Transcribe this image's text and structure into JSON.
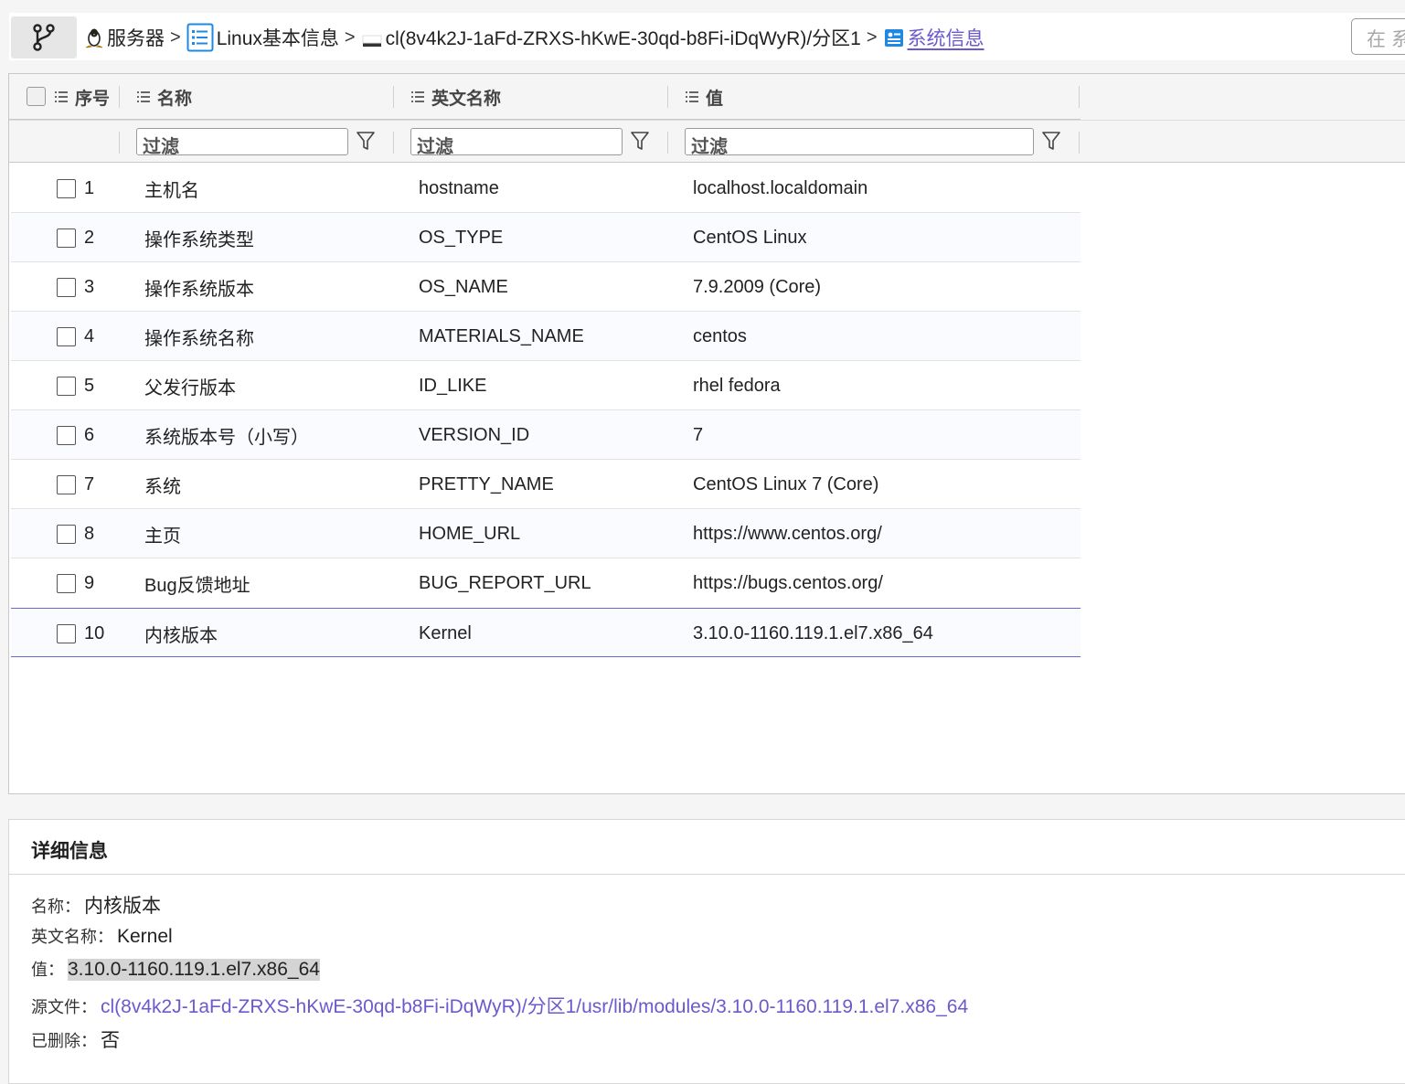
{
  "breadcrumb": {
    "items": [
      {
        "label": "服务器",
        "icon": "linux-penguin-icon"
      },
      {
        "label": "Linux基本信息",
        "icon": "list-icon"
      },
      {
        "label": "cl(8v4k2J-1aFd-ZRXS-hKwE-30qd-b8Fi-iDqWyR)/分区1",
        "icon": "disk-icon"
      },
      {
        "label": "系统信息",
        "icon": "info-card-icon",
        "active": true
      }
    ],
    "separator": ">"
  },
  "search": {
    "placeholder": "在系"
  },
  "grid": {
    "columns": {
      "index": "序号",
      "name": "名称",
      "english_name": "英文名称",
      "value": "值"
    },
    "filter_placeholder": "过滤",
    "rows": [
      {
        "index": "1",
        "name": "主机名",
        "english_name": "hostname",
        "value": "localhost.localdomain"
      },
      {
        "index": "2",
        "name": "操作系统类型",
        "english_name": "OS_TYPE",
        "value": "CentOS Linux"
      },
      {
        "index": "3",
        "name": "操作系统版本",
        "english_name": "OS_NAME",
        "value": "7.9.2009 (Core)"
      },
      {
        "index": "4",
        "name": "操作系统名称",
        "english_name": "MATERIALS_NAME",
        "value": "centos"
      },
      {
        "index": "5",
        "name": "父发行版本",
        "english_name": "ID_LIKE",
        "value": "rhel fedora"
      },
      {
        "index": "6",
        "name": "系统版本号（小写）",
        "english_name": "VERSION_ID",
        "value": "7"
      },
      {
        "index": "7",
        "name": "系统",
        "english_name": "PRETTY_NAME",
        "value": "CentOS Linux 7 (Core)"
      },
      {
        "index": "8",
        "name": "主页",
        "english_name": "HOME_URL",
        "value": "https://www.centos.org/"
      },
      {
        "index": "9",
        "name": "Bug反馈地址",
        "english_name": "BUG_REPORT_URL",
        "value": "https://bugs.centos.org/"
      },
      {
        "index": "10",
        "name": "内核版本",
        "english_name": "Kernel",
        "value": "3.10.0-1160.119.1.el7.x86_64"
      }
    ],
    "selected_row": "10"
  },
  "detail": {
    "title": "详细信息",
    "name_label": "名称：",
    "name_value": "内核版本",
    "english_label": "英文名称：",
    "english_value": "Kernel",
    "value_label": "值：",
    "value_value": "3.10.0-1160.119.1.el7.x86_64",
    "source_label": "源文件：",
    "source_value": "cl(8v4k2J-1aFd-ZRXS-hKwE-30qd-b8Fi-iDqWyR)/分区1/usr/lib/modules/3.10.0-1160.119.1.el7.x86_64",
    "deleted_label": "已删除：",
    "deleted_value": "否"
  },
  "colors": {
    "accent": "#6a5acd",
    "selected_border": "#6a6ad6",
    "icon_blue": "#1e88e5"
  }
}
